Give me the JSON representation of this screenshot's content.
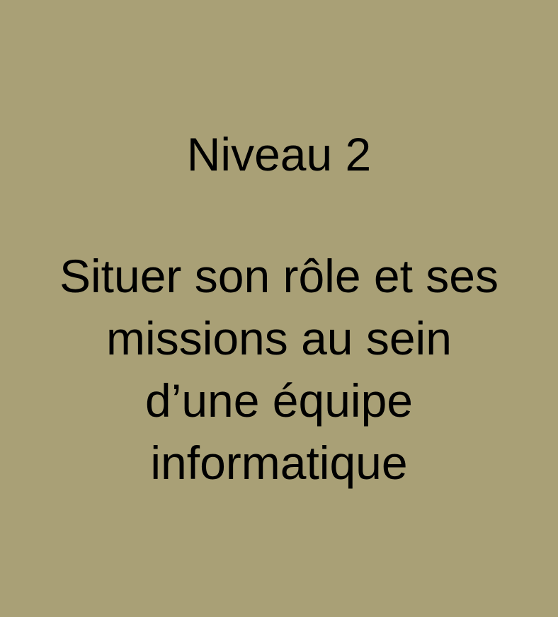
{
  "slide": {
    "level": "Niveau 2",
    "title_lines": [
      "Situer son rôle et ses",
      "missions au sein",
      "d’une équipe",
      "informatique"
    ]
  },
  "colors": {
    "background": "#a9a076",
    "text": "#000000"
  }
}
